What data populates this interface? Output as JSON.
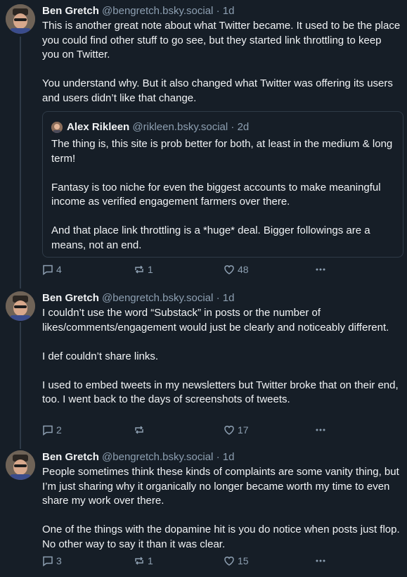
{
  "posts": [
    {
      "author": "Ben Gretch",
      "handle": "@bengretch.bsky.social",
      "separator": "·",
      "age": "1d",
      "text": "This is another great note about what Twitter became. It used to be the place you could find other stuff to go see, but they started link throttling to keep you on Twitter.\n\nYou understand why. But it also changed what Twitter was offering its users and users didn’t like that change.",
      "quote": {
        "author": "Alex Rikleen",
        "handle": "@rikleen.bsky.social",
        "separator": "·",
        "age": "2d",
        "text": "The thing is, this site is prob better for both, at least in the medium & long term!\n\nFantasy is too niche for even the biggest accounts to make meaningful income as verified engagement farmers over there.\n\nAnd that place link throttling is a *huge* deal. Bigger followings are a means, not an end."
      },
      "replies": "4",
      "reposts": "1",
      "likes": "48"
    },
    {
      "author": "Ben Gretch",
      "handle": "@bengretch.bsky.social",
      "separator": "·",
      "age": "1d",
      "text": "I couldn’t use the word “Substack” in posts or the number of likes/comments/engagement would just be clearly and noticeably different.\n\nI def couldn’t share links.\n\nI used to embed tweets in my newsletters but Twitter broke that on their end, too. I went back to the days of screenshots of tweets.",
      "replies": "2",
      "reposts": "",
      "likes": "17"
    },
    {
      "author": "Ben Gretch",
      "handle": "@bengretch.bsky.social",
      "separator": "·",
      "age": "1d",
      "text": "People sometimes think these kinds of complaints are some vanity thing, but I’m just sharing why it organically no longer became worth my time to even share my work over there.\n\nOne of the things with the dopamine hit is you do notice when posts just flop. No other way to say it than it was clear.",
      "replies": "3",
      "reposts": "1",
      "likes": "15"
    }
  ],
  "icons": {
    "reply": "speech-bubble-icon",
    "repost": "repost-arrows-icon",
    "like": "heart-icon",
    "more": "ellipsis-icon"
  },
  "colors": {
    "background": "#161e27",
    "text": "#f1f3f5",
    "muted": "#8d9fb1",
    "border": "#2e3a47"
  }
}
